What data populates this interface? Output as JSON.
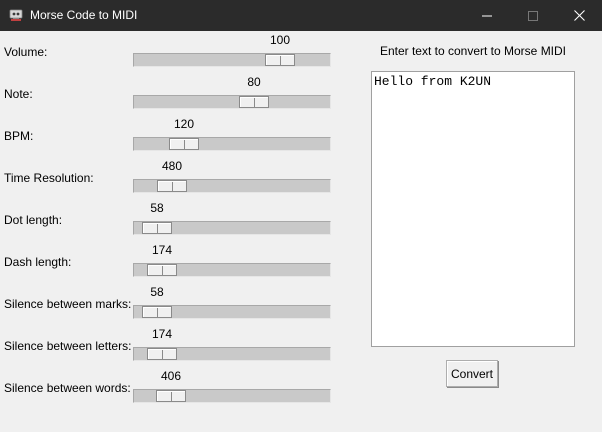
{
  "window": {
    "title": "Morse Code to MIDI",
    "icon": "app-icon",
    "controls": [
      "minimize-icon",
      "maximize-icon",
      "close-icon"
    ]
  },
  "sliders": [
    {
      "label": "Volume:",
      "value": "100",
      "level": 0.79
    },
    {
      "label": "Note:",
      "value": "80",
      "level": 0.63
    },
    {
      "label": "BPM:",
      "value": "120",
      "level": 0.21
    },
    {
      "label": "Time Resolution:",
      "value": "480",
      "level": 0.14
    },
    {
      "label": "Dot length:",
      "value": "58",
      "level": 0.05
    },
    {
      "label": "Dash length:",
      "value": "174",
      "level": 0.08
    },
    {
      "label": "Silence between marks:",
      "value": "58",
      "level": 0.05
    },
    {
      "label": "Silence between letters:",
      "value": "174",
      "level": 0.08
    },
    {
      "label": "Silence between words:",
      "value": "406",
      "level": 0.13
    }
  ],
  "text_panel": {
    "prompt": "Enter text to convert to Morse MIDI",
    "value": "Hello from K2UN"
  },
  "convert_label": "Convert"
}
